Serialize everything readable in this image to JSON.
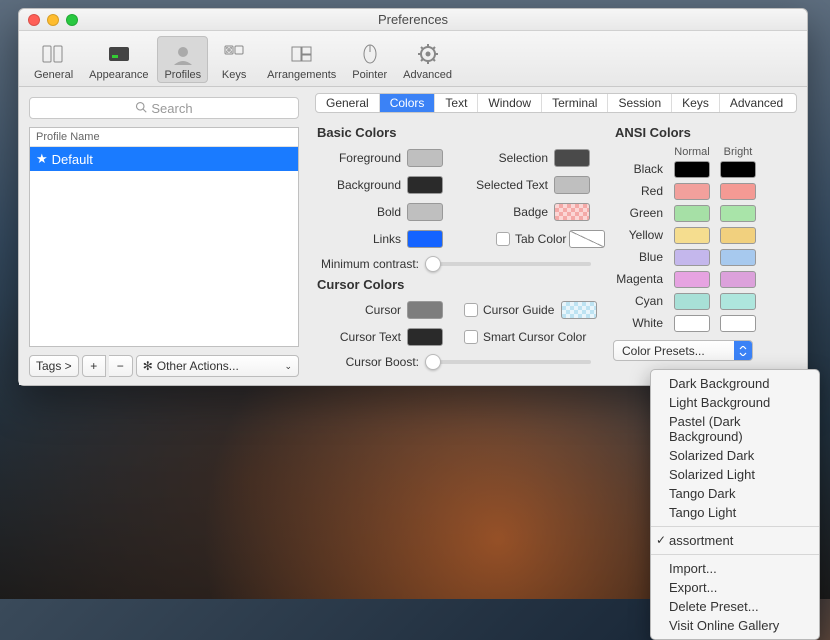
{
  "window": {
    "title": "Preferences"
  },
  "toolbar": {
    "items": [
      {
        "label": "General"
      },
      {
        "label": "Appearance"
      },
      {
        "label": "Profiles"
      },
      {
        "label": "Keys"
      },
      {
        "label": "Arrangements"
      },
      {
        "label": "Pointer"
      },
      {
        "label": "Advanced"
      }
    ],
    "selected_index": 2
  },
  "search": {
    "placeholder": "Search"
  },
  "profiles": {
    "header": "Profile Name",
    "items": [
      {
        "name": "Default",
        "starred": true
      }
    ],
    "tags_label": "Tags >",
    "other_actions": "Other Actions..."
  },
  "subtabs": {
    "items": [
      "General",
      "Colors",
      "Text",
      "Window",
      "Terminal",
      "Session",
      "Keys",
      "Advanced"
    ],
    "selected_index": 1
  },
  "basic": {
    "title": "Basic Colors",
    "rows": {
      "foreground": {
        "label": "Foreground",
        "color": "#bfbfbf"
      },
      "background": {
        "label": "Background",
        "color": "#2a2a2a"
      },
      "bold": {
        "label": "Bold",
        "color": "#bfbfbf"
      },
      "links": {
        "label": "Links",
        "color": "#1463ff"
      },
      "selection": {
        "label": "Selection",
        "color": "#4a4a4a"
      },
      "selected_text": {
        "label": "Selected Text",
        "color": "#bfbfbf"
      },
      "badge": {
        "label": "Badge"
      },
      "tab_color": {
        "label": "Tab Color"
      }
    },
    "min_contrast": "Minimum contrast:"
  },
  "cursor": {
    "title": "Cursor Colors",
    "cursor": {
      "label": "Cursor",
      "color": "#7d7d7d"
    },
    "cursor_text": {
      "label": "Cursor Text",
      "color": "#2a2a2a"
    },
    "guide": "Cursor Guide",
    "smart": "Smart Cursor Color",
    "boost": "Cursor Boost:"
  },
  "ansi": {
    "title": "ANSI Colors",
    "normal_label": "Normal",
    "bright_label": "Bright",
    "rows": [
      {
        "label": "Black",
        "normal": "#000000",
        "bright": "#000000"
      },
      {
        "label": "Red",
        "normal": "#f2a09c",
        "bright": "#f49a94"
      },
      {
        "label": "Green",
        "normal": "#a6e0a6",
        "bright": "#a9e4a9"
      },
      {
        "label": "Yellow",
        "normal": "#f5dd8f",
        "bright": "#f1d07e"
      },
      {
        "label": "Blue",
        "normal": "#c4b7ec",
        "bright": "#a7c9ee"
      },
      {
        "label": "Magenta",
        "normal": "#e6a3e1",
        "bright": "#dca1db"
      },
      {
        "label": "Cyan",
        "normal": "#a8e0d7",
        "bright": "#aee6dd"
      },
      {
        "label": "White",
        "normal": "#ffffff",
        "bright": "#ffffff"
      }
    ]
  },
  "presets": {
    "label": "Color Presets...",
    "items": [
      "Dark Background",
      "Light Background",
      "Pastel (Dark Background)",
      "Solarized Dark",
      "Solarized Light",
      "Tango Dark",
      "Tango Light"
    ],
    "checked": "assortment",
    "actions": [
      "Import...",
      "Export...",
      "Delete Preset...",
      "Visit Online Gallery"
    ]
  }
}
